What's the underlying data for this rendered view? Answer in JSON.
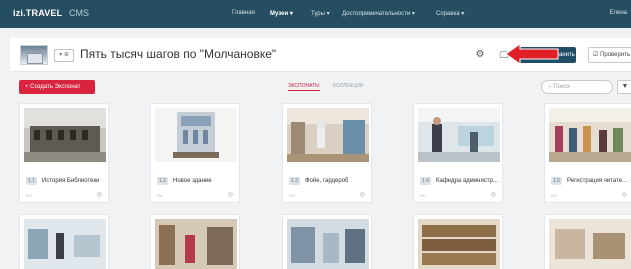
{
  "topnav": {
    "logo": "izi.TRAVEL",
    "logo_sub": "CMS",
    "items": [
      "Главная",
      "Музеи ▾",
      "Туры ▾",
      "Достопримечательности ▾",
      "Справка ▾"
    ],
    "user": "Елена"
  },
  "header": {
    "lang": "▾ ⊕",
    "title": "Пять тысяч шагов по \"Молчановке\"",
    "save_label": "Сохранить",
    "check_label": "Проверить"
  },
  "toolbar": {
    "create_label": "+ Создать Экспонат",
    "tab_exhibits": "ЭКСПОНАТЫ",
    "tab_collections": "КОЛЛЕКЦИИ",
    "search_placeholder": "Поиск"
  },
  "cards": [
    {
      "badge": "1.1",
      "title": "История Библиотеки",
      "lang": "RU"
    },
    {
      "badge": "1.2",
      "title": "Новое здание",
      "lang": "RU"
    },
    {
      "badge": "1.3",
      "title": "Фойе, гардероб",
      "lang": "RU"
    },
    {
      "badge": "1.4",
      "title": "Кафедра администр...",
      "lang": "RU"
    },
    {
      "badge": "1.5",
      "title": "Регистрация читате...",
      "lang": "RU"
    }
  ],
  "icons": {
    "gear": "gear-icon",
    "monitor": "monitor-icon",
    "check": "check-icon",
    "globe": "globe-icon",
    "filter": "filter-icon",
    "search": "search-icon",
    "arrow": "red-arrow-annotation"
  },
  "colors": {
    "nav_bg": "#254e62",
    "accent_red": "#d8243c",
    "save_btn": "#1f4e66"
  }
}
